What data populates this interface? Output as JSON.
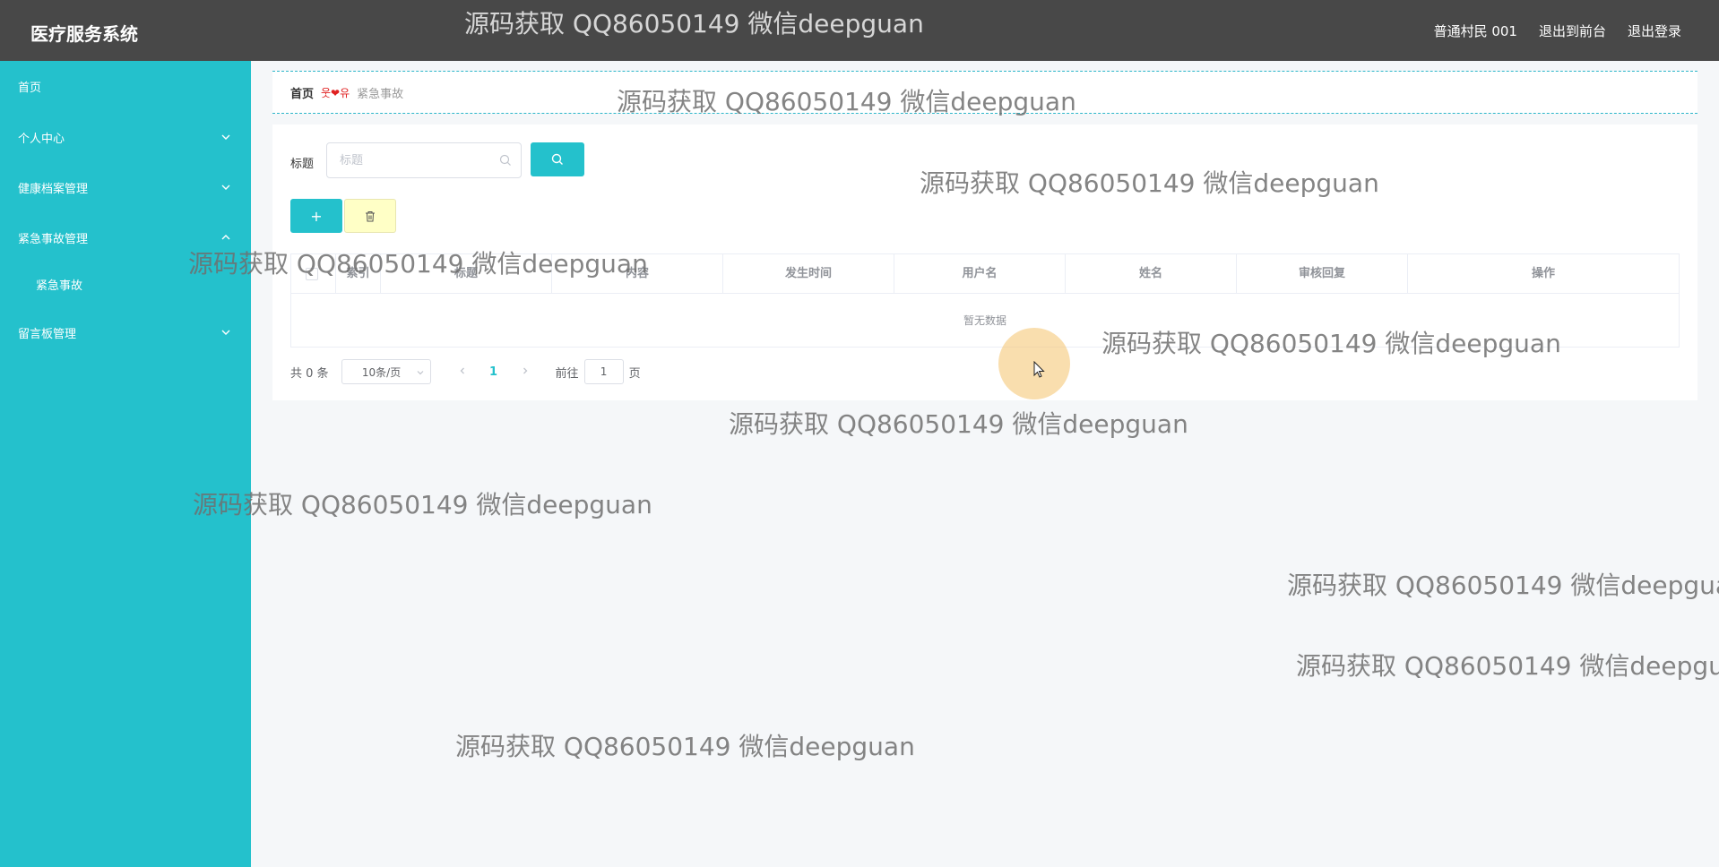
{
  "header": {
    "brand": "医疗服务系统",
    "user": "普通村民 001",
    "to_front": "退出到前台",
    "logout": "退出登录"
  },
  "sidebar": {
    "items": [
      {
        "label": "首页",
        "has_chevron": false
      },
      {
        "label": "个人中心",
        "has_chevron": true
      },
      {
        "label": "健康档案管理",
        "has_chevron": true
      },
      {
        "label": "紧急事故管理",
        "has_chevron": true,
        "expanded": true
      },
      {
        "label": "紧急事故",
        "sub": true
      },
      {
        "label": "留言板管理",
        "has_chevron": true
      }
    ]
  },
  "breadcrumb": {
    "home": "首页",
    "separator": "웃❤유",
    "current": "紧急事故"
  },
  "search": {
    "label": "标题",
    "placeholder": "标题"
  },
  "toolbar": {
    "add_label": "+",
    "delete_icon": "trash-icon"
  },
  "table": {
    "columns": [
      "索引",
      "标题",
      "内容",
      "发生时间",
      "用户名",
      "姓名",
      "审核回复",
      "操作"
    ],
    "empty_text": "暂无数据"
  },
  "pager": {
    "total": "共 0 条",
    "page_size": "10条/页",
    "current_page": "1",
    "goto_prefix": "前往",
    "goto_value": "1",
    "goto_suffix": "页"
  },
  "watermark": "源码获取 QQ86050149 微信deepguan",
  "colors": {
    "accent": "#24c1cc",
    "header_bg": "#484848",
    "delete_bg": "#ffffc6"
  }
}
